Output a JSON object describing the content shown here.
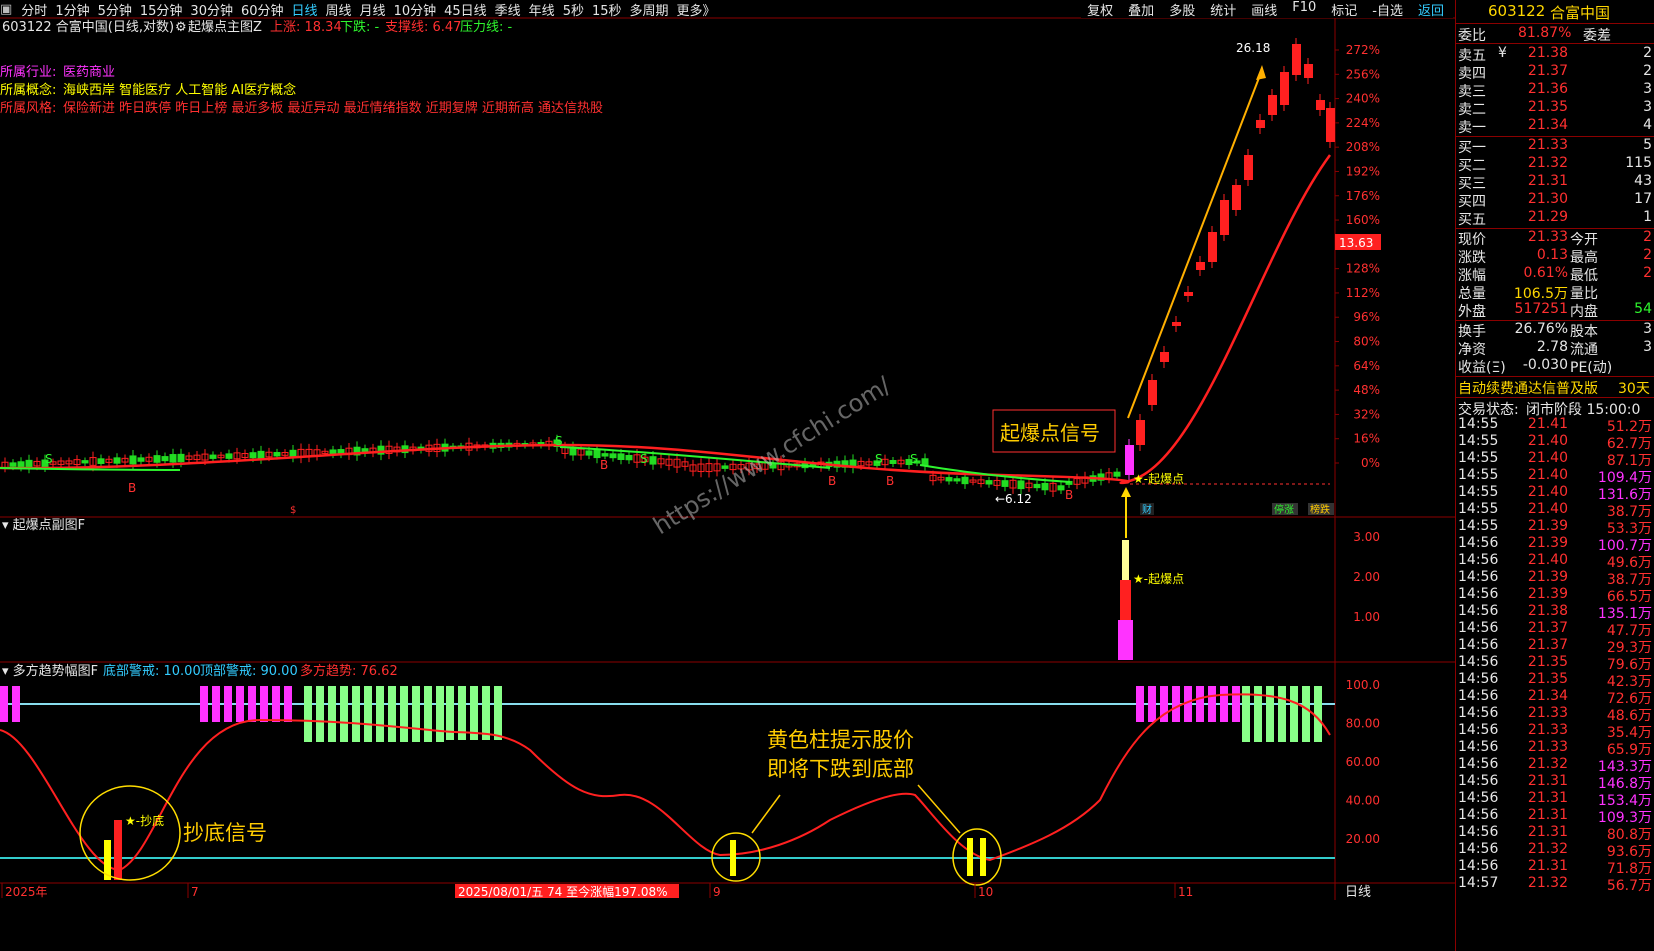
{
  "toolbar": {
    "periods": [
      "分时",
      "1分钟",
      "5分钟",
      "15分钟",
      "30分钟",
      "60分钟",
      "日线",
      "周线",
      "月线",
      "10分钟",
      "45日线",
      "季线",
      "年线",
      "5秒",
      "15秒",
      "多周期",
      "更多》"
    ],
    "active_period": "日线",
    "tools": [
      "复权",
      "叠加",
      "多股",
      "统计",
      "画线",
      "F10",
      "标记",
      "-自选",
      "返回"
    ]
  },
  "main_chart": {
    "title": "603122 合富中国(日线,对数)",
    "indicator_name": "起爆点主图Z",
    "up_label": "上涨: 18.34",
    "down_label": "下跌: -",
    "support_label": "支撑线: 6.47",
    "pressure_label": "压力线: -",
    "industry_label": "所属行业:",
    "industry_value": "医药商业",
    "concept_label": "所属概念:",
    "concept_value": "海峡西岸 智能医疗 人工智能 AI医疗概念",
    "style_label": "所属风格:",
    "style_value": "保险新进 昨日跌停 昨日上榜 最近多板 最近异动 最近情绪指数 近期复牌 近期新高 通达信热股",
    "high_mark": "26.18",
    "low_mark": "6.12",
    "price_tag": "13.63",
    "signal_box": "起爆点信号",
    "signal_label": "★-起爆点",
    "y_ticks": [
      "272%",
      "256%",
      "240%",
      "224%",
      "208%",
      "192%",
      "176%",
      "160%",
      "144%",
      "128%",
      "112%",
      "96%",
      "80%",
      "64%",
      "48%",
      "32%",
      "16%",
      "0%"
    ],
    "markers": {
      "s": "S",
      "b": "B",
      "fin": "财",
      "limit": "停涨",
      "rank": "榜跌"
    }
  },
  "sub_chart1": {
    "title": "起爆点副图F",
    "signal_label": "★-起爆点",
    "y_ticks": [
      "3.00",
      "2.00",
      "1.00"
    ]
  },
  "sub_chart2": {
    "title": "多方趋势幅图F",
    "bottom_warn": "底部警戒: 10.00",
    "top_warn": "顶部警戒: 90.00",
    "trend": "多方趋势: 76.62",
    "y_ticks": [
      "100.0",
      "80.00",
      "60.00",
      "40.00",
      "20.00"
    ],
    "annotation_bottom": "抄底信号",
    "bottom_mark": "★-抄底",
    "annotation_yellow_line1": "黄色柱提示股价",
    "annotation_yellow_line2": "即将下跌到底部"
  },
  "x_axis": {
    "labels": [
      "2025年",
      "7",
      "9",
      "10",
      "11"
    ],
    "info": "2025/08/01/五 74 至今涨幅197.08%",
    "period": "日线"
  },
  "watermark": "https://www.cfchi.com/",
  "quote": {
    "code": "603122",
    "name": "合富中国",
    "weibi_label": "委比",
    "weibi": "81.87%",
    "weicha_label": "委差",
    "asks": [
      {
        "label": "卖五",
        "price": "21.38",
        "vol": "2",
        "mark": "¥"
      },
      {
        "label": "卖四",
        "price": "21.37",
        "vol": "2"
      },
      {
        "label": "卖三",
        "price": "21.36",
        "vol": "3"
      },
      {
        "label": "卖二",
        "price": "21.35",
        "vol": "3"
      },
      {
        "label": "卖一",
        "price": "21.34",
        "vol": "4"
      }
    ],
    "bids": [
      {
        "label": "买一",
        "price": "21.33",
        "vol": "5"
      },
      {
        "label": "买二",
        "price": "21.32",
        "vol": "115"
      },
      {
        "label": "买三",
        "price": "21.31",
        "vol": "43"
      },
      {
        "label": "买四",
        "price": "21.30",
        "vol": "17"
      },
      {
        "label": "买五",
        "price": "21.29",
        "vol": "1"
      }
    ],
    "stats": [
      {
        "l1": "现价",
        "v1": "21.33",
        "l2": "今开",
        "v2": "2"
      },
      {
        "l1": "涨跌",
        "v1": "0.13",
        "l2": "最高",
        "v2": "2"
      },
      {
        "l1": "涨幅",
        "v1": "0.61%",
        "l2": "最低",
        "v2": "2"
      },
      {
        "l1": "总量",
        "v1": "106.5万",
        "l2": "量比",
        "v2": ""
      },
      {
        "l1": "外盘",
        "v1": "517251",
        "l2": "内盘",
        "v2": "54"
      }
    ],
    "stats2": [
      {
        "l1": "换手",
        "v1": "26.76%",
        "l2": "股本",
        "v2": "3"
      },
      {
        "l1": "净资",
        "v1": "2.78",
        "l2": "流通",
        "v2": "3"
      },
      {
        "l1": "收益(Ξ)",
        "v1": "-0.030",
        "l2": "PE(动)",
        "v2": ""
      }
    ],
    "ad": "自动续费通达信普及版",
    "ad2": "30天",
    "status_label": "交易状态:",
    "status_value": "闭市阶段 15:00:0",
    "ticks": [
      {
        "t": "14:55",
        "p": "21.41",
        "v": "51.2万",
        "d": "r"
      },
      {
        "t": "14:55",
        "p": "21.40",
        "v": "62.7万",
        "d": "r"
      },
      {
        "t": "14:55",
        "p": "21.40",
        "v": "87.1万",
        "d": "r"
      },
      {
        "t": "14:55",
        "p": "21.40",
        "v": "109.4万",
        "d": "m"
      },
      {
        "t": "14:55",
        "p": "21.40",
        "v": "131.6万",
        "d": "m"
      },
      {
        "t": "14:55",
        "p": "21.40",
        "v": "38.7万",
        "d": "r"
      },
      {
        "t": "14:55",
        "p": "21.39",
        "v": "53.3万",
        "d": "r"
      },
      {
        "t": "14:56",
        "p": "21.39",
        "v": "100.7万",
        "d": "m"
      },
      {
        "t": "14:56",
        "p": "21.40",
        "v": "49.6万",
        "d": "r"
      },
      {
        "t": "14:56",
        "p": "21.39",
        "v": "38.7万",
        "d": "r"
      },
      {
        "t": "14:56",
        "p": "21.39",
        "v": "66.5万",
        "d": "r"
      },
      {
        "t": "14:56",
        "p": "21.38",
        "v": "135.1万",
        "d": "m"
      },
      {
        "t": "14:56",
        "p": "21.37",
        "v": "47.7万",
        "d": "r"
      },
      {
        "t": "14:56",
        "p": "21.37",
        "v": "29.3万",
        "d": "r"
      },
      {
        "t": "14:56",
        "p": "21.35",
        "v": "79.6万",
        "d": "r"
      },
      {
        "t": "14:56",
        "p": "21.35",
        "v": "42.3万",
        "d": "r"
      },
      {
        "t": "14:56",
        "p": "21.34",
        "v": "72.6万",
        "d": "r"
      },
      {
        "t": "14:56",
        "p": "21.33",
        "v": "48.6万",
        "d": "r"
      },
      {
        "t": "14:56",
        "p": "21.33",
        "v": "35.4万",
        "d": "r"
      },
      {
        "t": "14:56",
        "p": "21.33",
        "v": "65.9万",
        "d": "r"
      },
      {
        "t": "14:56",
        "p": "21.32",
        "v": "143.3万",
        "d": "m"
      },
      {
        "t": "14:56",
        "p": "21.31",
        "v": "146.8万",
        "d": "m"
      },
      {
        "t": "14:56",
        "p": "21.31",
        "v": "153.4万",
        "d": "m"
      },
      {
        "t": "14:56",
        "p": "21.31",
        "v": "109.3万",
        "d": "m"
      },
      {
        "t": "14:56",
        "p": "21.31",
        "v": "80.8万",
        "d": "r"
      },
      {
        "t": "14:56",
        "p": "21.32",
        "v": "93.6万",
        "d": "r"
      },
      {
        "t": "14:56",
        "p": "21.31",
        "v": "71.8万",
        "d": "r"
      },
      {
        "t": "14:57",
        "p": "21.32",
        "v": "56.7万",
        "d": "r"
      }
    ]
  },
  "colors": {
    "up": "#ff2020",
    "down": "#22dd22",
    "bg": "#000000",
    "grid": "#8b0000",
    "magenta": "#ff33ff",
    "lightgreen": "#88ff88",
    "yellow": "#ffff00",
    "cyan": "#33cccc"
  }
}
